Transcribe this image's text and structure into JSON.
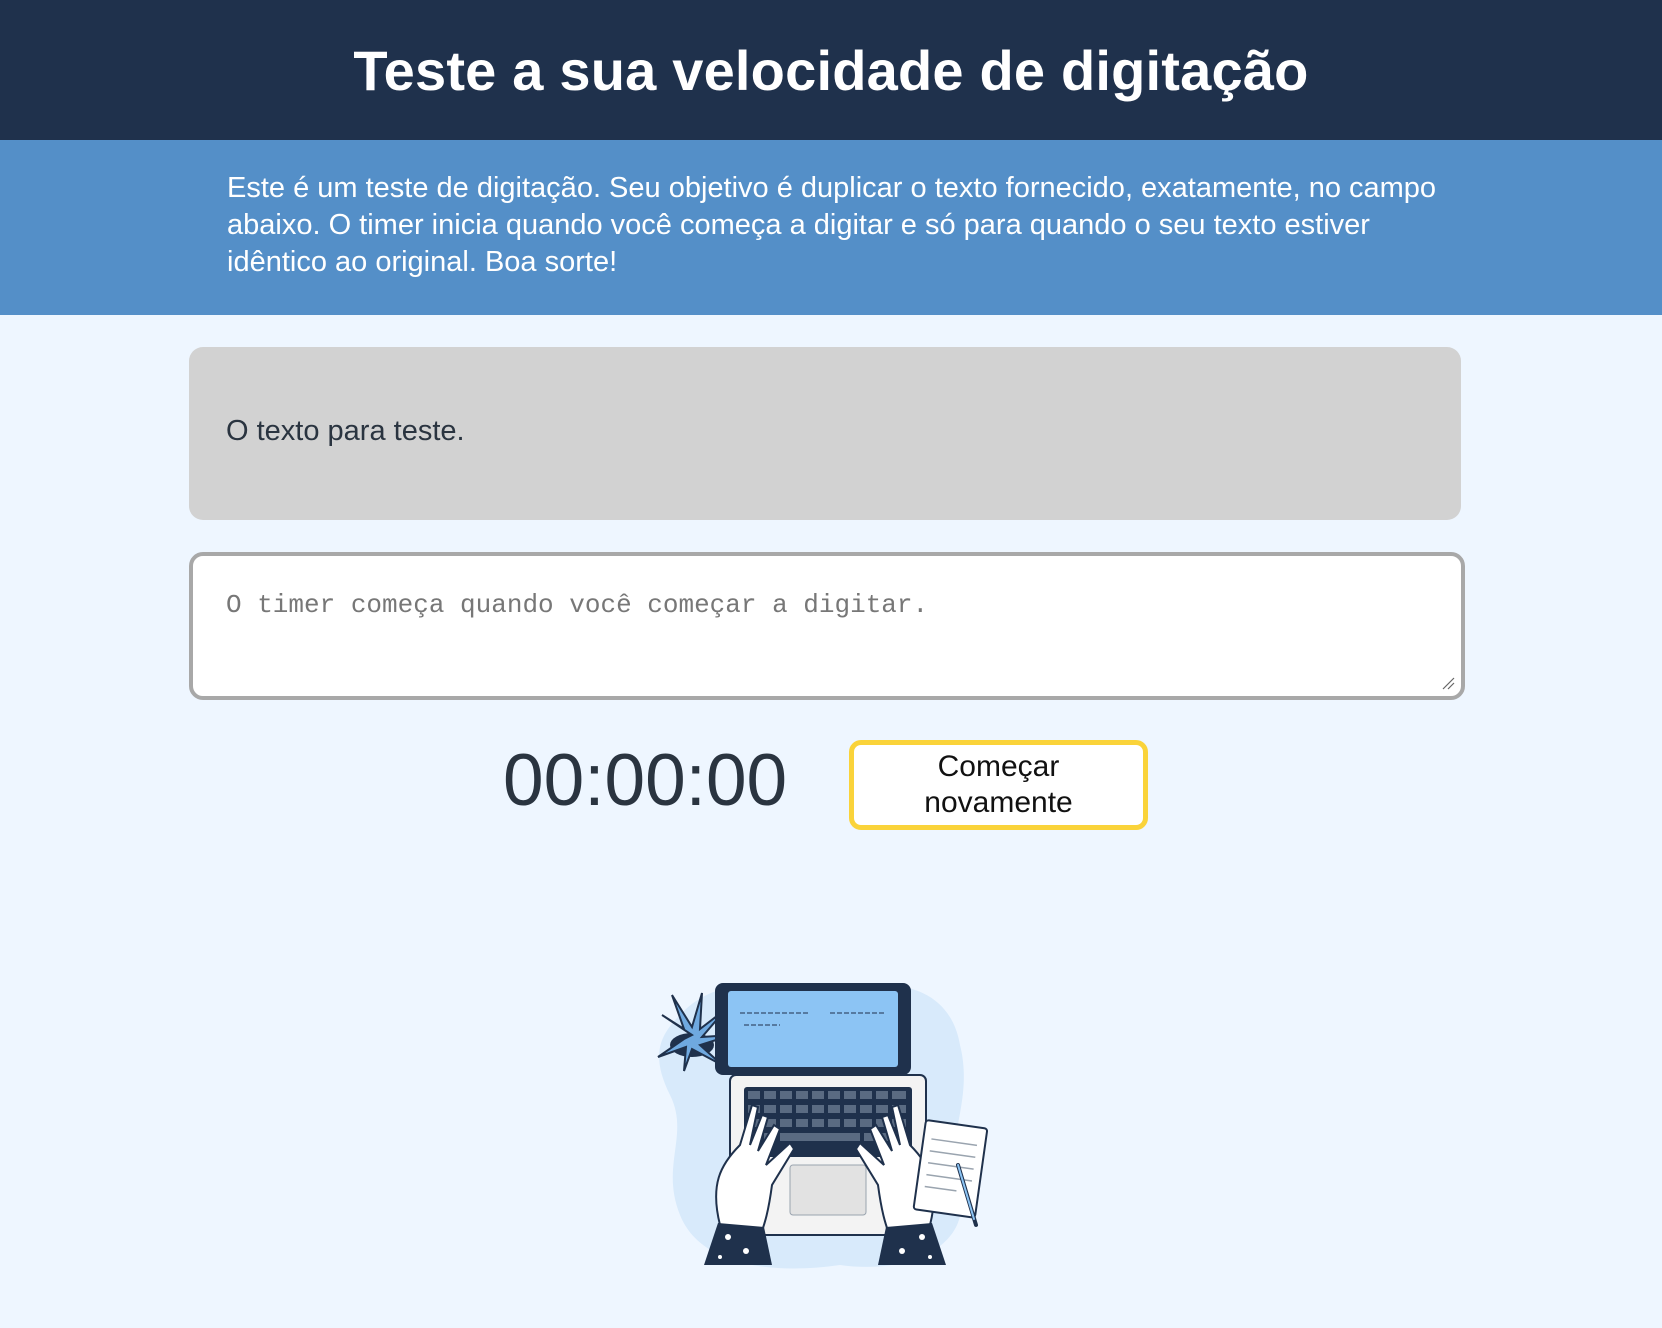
{
  "header": {
    "title": "Teste a sua velocidade de digitação"
  },
  "intro": {
    "text": "Este é um teste de digitação. Seu objetivo é duplicar o texto fornecido, exatamente, no campo abaixo. O timer inicia quando você começa a digitar e só para quando o seu texto estiver idêntico ao original. Boa sorte!"
  },
  "origin": {
    "text": "O texto para teste."
  },
  "input": {
    "value": "",
    "placeholder": "O timer começa quando você começar a digitar."
  },
  "timer": {
    "value": "00:00:00"
  },
  "reset_button": {
    "label": "Começar novamente"
  },
  "illustration": {
    "icon": "laptop-typing-illustration"
  },
  "colors": {
    "header_bg": "#1F314C",
    "intro_bg": "#548FC8",
    "page_bg": "#EEF6FF",
    "origin_bg": "#D2D2D2",
    "button_border": "#FAD33A",
    "illustration_accent": "#8CC4F4"
  }
}
